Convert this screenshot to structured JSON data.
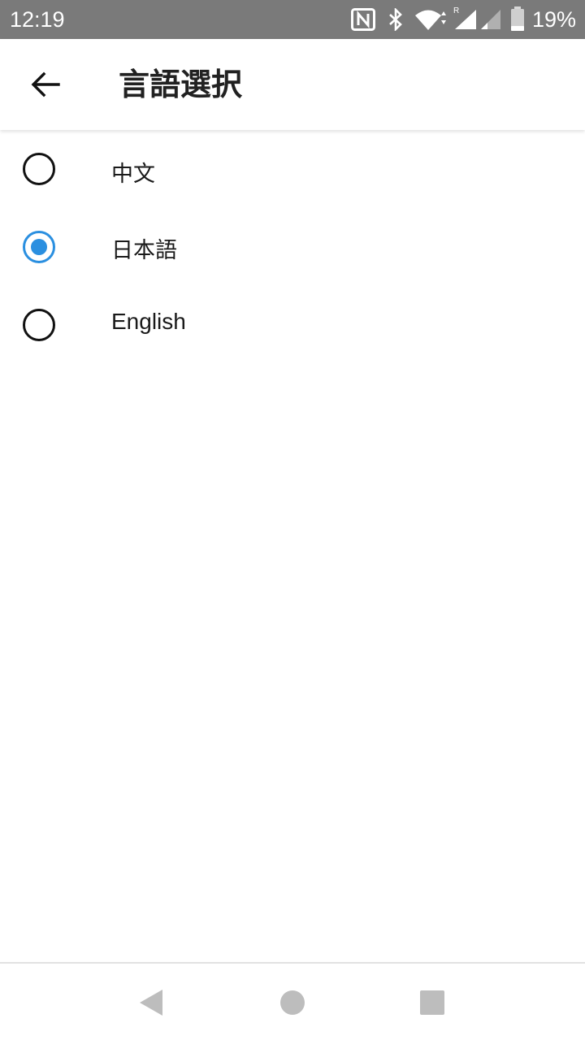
{
  "status_bar": {
    "time": "12:19",
    "battery": "19%",
    "icons": [
      "nfc-icon",
      "bluetooth-icon",
      "wifi-icon",
      "signal-icon",
      "signal-weak-icon",
      "battery-icon"
    ]
  },
  "header": {
    "title": "言語選択",
    "back_icon": "arrow-left-icon"
  },
  "languages": {
    "options": [
      {
        "label": "中文",
        "selected": false
      },
      {
        "label": "日本語",
        "selected": true
      },
      {
        "label": "English",
        "selected": false
      }
    ],
    "accent_color": "#2a8fe0"
  },
  "nav_bar": {
    "icons": [
      "back-triangle-icon",
      "home-circle-icon",
      "recents-square-icon"
    ]
  }
}
